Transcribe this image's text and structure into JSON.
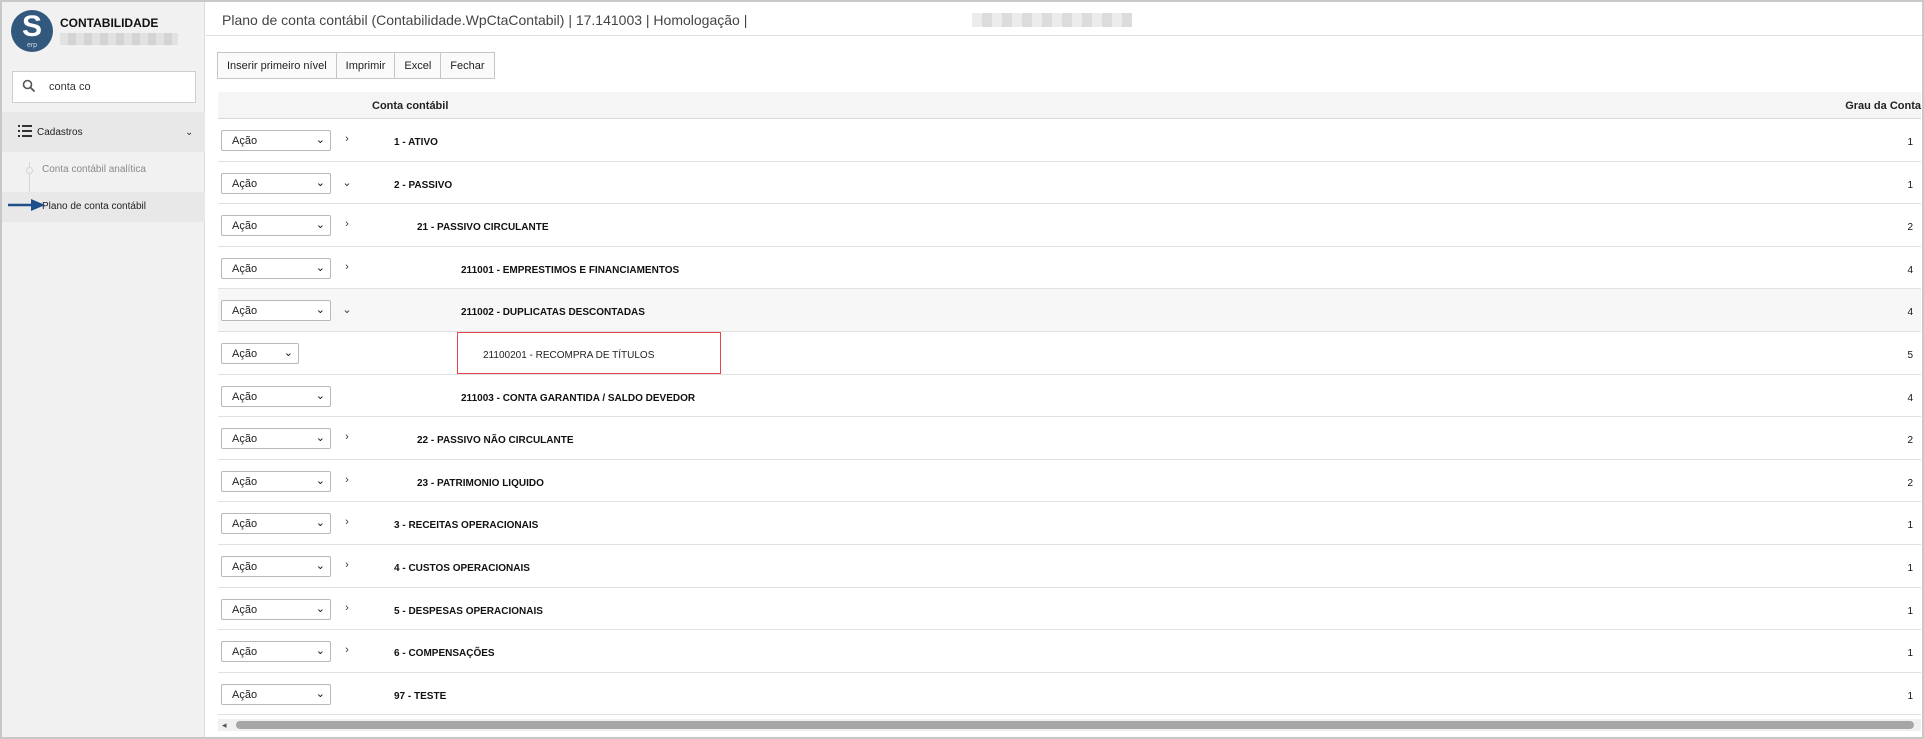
{
  "sidebar": {
    "logo_text": "S",
    "logo_sub": "erp",
    "app_title": "CONTABILIDADE",
    "search": {
      "value": "conta co"
    },
    "group": {
      "label": "Cadastros"
    },
    "items": [
      {
        "label": "Conta contábil analítica"
      },
      {
        "label": "Plano de conta contábil"
      }
    ]
  },
  "header": {
    "title": "Plano de conta contábil (Contabilidade.WpCtaContabil) | 17.141003 | Homologação |"
  },
  "toolbar": {
    "insert_label": "Inserir primeiro nível",
    "print_label": "Imprimir",
    "excel_label": "Excel",
    "close_label": "Fechar"
  },
  "grid": {
    "columns": {
      "account": "Conta contábil",
      "grade": "Grau da Conta"
    },
    "action_label": "Ação",
    "rows": [
      {
        "account": "1 - ATIVO",
        "grade": "1",
        "level": 1,
        "expander": "›",
        "bold": true
      },
      {
        "account": "2 - PASSIVO",
        "grade": "1",
        "level": 1,
        "expander": "⌄",
        "bold": true
      },
      {
        "account": "21 - PASSIVO CIRCULANTE",
        "grade": "2",
        "level": 2,
        "expander": "›",
        "bold": true
      },
      {
        "account": "211001 - EMPRESTIMOS E FINANCIAMENTOS",
        "grade": "4",
        "level": 3,
        "expander": "›",
        "bold": true
      },
      {
        "account": "211002 - DUPLICATAS DESCONTADAS",
        "grade": "4",
        "level": 3,
        "expander": "⌄",
        "bold": true,
        "highlight": true
      },
      {
        "account": "21100201 - RECOMPRA DE TÍTULOS",
        "grade": "5",
        "level": 4,
        "expander": "",
        "bold": false,
        "short_select": true,
        "boxed": true
      },
      {
        "account": "211003 - CONTA GARANTIDA / SALDO DEVEDOR",
        "grade": "4",
        "level": 3,
        "expander": "",
        "bold": true
      },
      {
        "account": "22 - PASSIVO NÃO CIRCULANTE",
        "grade": "2",
        "level": 2,
        "expander": "›",
        "bold": true
      },
      {
        "account": "23 - PATRIMONIO LIQUIDO",
        "grade": "2",
        "level": 2,
        "expander": "›",
        "bold": true
      },
      {
        "account": "3 - RECEITAS OPERACIONAIS",
        "grade": "1",
        "level": 1,
        "expander": "›",
        "bold": true
      },
      {
        "account": "4 - CUSTOS OPERACIONAIS",
        "grade": "1",
        "level": 1,
        "expander": "›",
        "bold": true
      },
      {
        "account": "5 - DESPESAS OPERACIONAIS",
        "grade": "1",
        "level": 1,
        "expander": "›",
        "bold": true
      },
      {
        "account": "6 - COMPENSAÇÕES",
        "grade": "1",
        "level": 1,
        "expander": "›",
        "bold": true
      },
      {
        "account": "97 - TESTE",
        "grade": "1",
        "level": 1,
        "expander": "",
        "bold": true
      }
    ]
  },
  "colors": {
    "logo": "#33587e",
    "highlight_box": "#e0474c",
    "arrow": "#1f4e8c"
  }
}
